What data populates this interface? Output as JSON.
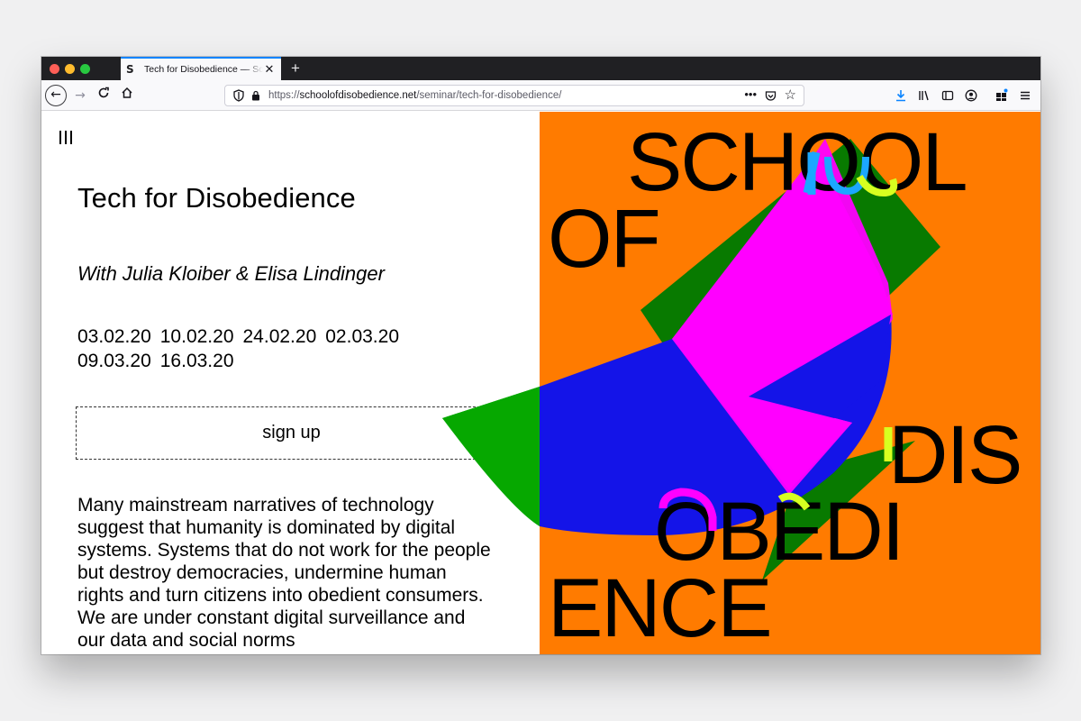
{
  "browser": {
    "tab_title": "Tech for Disobedience — School of Disobedience",
    "tab_favicon": "S",
    "url_scheme": "https://",
    "url_domain": "schoolofdisobedience.net",
    "url_path": "/seminar/tech-for-disobedience/"
  },
  "page": {
    "title": "Tech for Disobedience",
    "subtitle": "With Julia Kloiber & Elisa Lindinger",
    "dates": [
      "03.02.20",
      "10.02.20",
      "24.02.20",
      "02.03.20",
      "09.03.20",
      "16.03.20"
    ],
    "signup_label": "sign up",
    "description": "Many mainstream narratives of technology suggest that humanity is dominated by digital systems. Systems that do not work for the people but destroy democracies, undermine human rights and turn citizens into obedient consumers. We are under constant digital surveillance and our data and social norms"
  },
  "logo": {
    "line1": "SCHOOL",
    "line2": "OF",
    "line3": "DIS",
    "line4": "OBEDI",
    "line5": "ENCE"
  },
  "colors": {
    "accent_orange": "#ff7b00",
    "green": "#087a00",
    "bright_green": "#06a800",
    "blue": "#1414e8",
    "magenta": "#ff00ff",
    "yellow": "#d8ff20",
    "cyan": "#1ca7ff"
  }
}
